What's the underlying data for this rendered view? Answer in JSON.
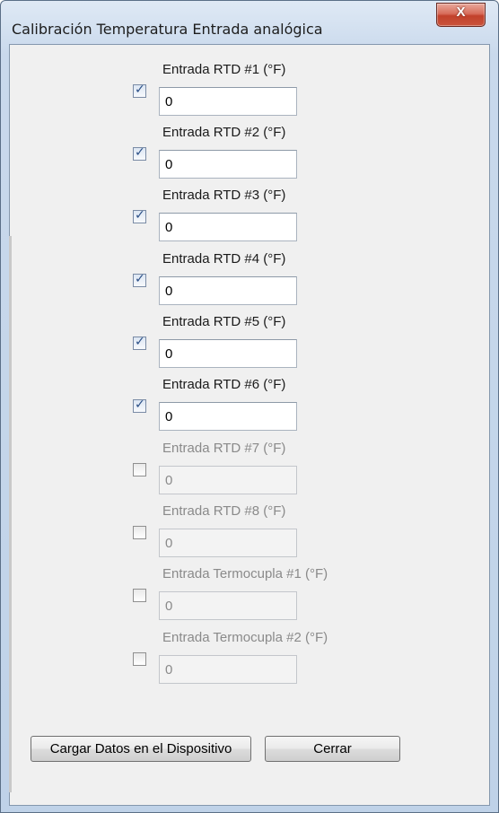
{
  "window": {
    "title": "Calibración Temperatura Entrada analógica",
    "close_glyph": "X"
  },
  "inputs": [
    {
      "label": "Entrada RTD #1 (°F)",
      "value": "0",
      "checked": true
    },
    {
      "label": "Entrada RTD #2 (°F)",
      "value": "0",
      "checked": true
    },
    {
      "label": "Entrada RTD #3 (°F)",
      "value": "0",
      "checked": true
    },
    {
      "label": "Entrada RTD #4 (°F)",
      "value": "0",
      "checked": true
    },
    {
      "label": "Entrada RTD #5 (°F)",
      "value": "0",
      "checked": true
    },
    {
      "label": "Entrada RTD #6 (°F)",
      "value": "0",
      "checked": true
    },
    {
      "label": "Entrada RTD #7 (°F)",
      "value": "0",
      "checked": false
    },
    {
      "label": "Entrada RTD #8 (°F)",
      "value": "0",
      "checked": false
    },
    {
      "label": "Entrada Termocupla #1 (°F)",
      "value": "0",
      "checked": false
    },
    {
      "label": "Entrada Termocupla #2 (°F)",
      "value": "0",
      "checked": false
    }
  ],
  "buttons": {
    "load_label": "Cargar Datos en el Dispositivo",
    "close_label": "Cerrar"
  },
  "colors": {
    "accent": "#2b4f86",
    "close_button": "#c9543c"
  }
}
